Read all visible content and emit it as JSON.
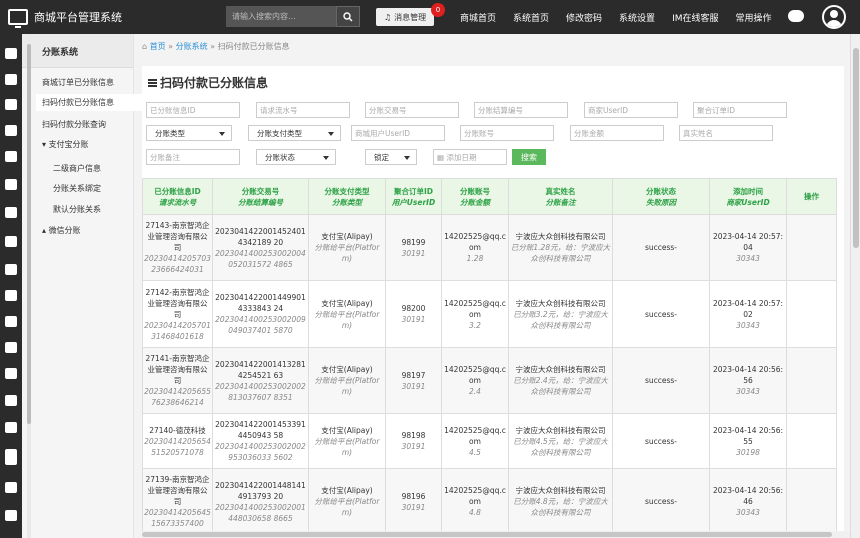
{
  "app": {
    "title": "商城平台管理系统"
  },
  "topbar": {
    "search_placeholder": "请输入搜索内容...",
    "msg_label": "消息管理",
    "msg_badge": "0",
    "nav": [
      "商城首页",
      "系统首页",
      "修改密码",
      "系统设置",
      "IM在线客服",
      "常用操作"
    ]
  },
  "sidebar": {
    "title": "分账系统",
    "items": [
      {
        "label": "商城订单已分账信息"
      },
      {
        "label": "扫码付款已分账信息"
      },
      {
        "label": "扫码付款分账查询"
      },
      {
        "label": "支付宝分账"
      },
      {
        "label": "二级商户信息"
      },
      {
        "label": "分账关系绑定"
      },
      {
        "label": "默认分账关系"
      },
      {
        "label": "微信分账"
      }
    ]
  },
  "breadcrumb": {
    "home": "首页",
    "sep": "»",
    "level1": "分账系统",
    "current": "扫码付款已分账信息"
  },
  "page": {
    "title": "扫码付款已分账信息"
  },
  "filters": {
    "row1": [
      "已分账信息ID",
      "请求流水号",
      "分账交易号",
      "分账结算编号",
      "商家UserID",
      "聚合订单ID"
    ],
    "row2_selects": [
      "分账类型",
      "分账支付类型"
    ],
    "row2_inputs": [
      "商城用户UserID",
      "分账账号",
      "分账金额",
      "真实姓名"
    ],
    "remark_placeholder": "分账备注",
    "status_select": "分账状态",
    "lock_select": "锁定",
    "date_placeholder": "添加日期",
    "search_label": "搜索"
  },
  "table": {
    "headers": [
      {
        "main": "已分账信息ID",
        "sub": "请求流水号"
      },
      {
        "main": "分账交易号",
        "sub": "分账结算编号"
      },
      {
        "main": "分账支付类型",
        "sub": "分账类型"
      },
      {
        "main": "聚合订单ID",
        "sub": "用户UserID"
      },
      {
        "main": "分账账号",
        "sub": "分账金额"
      },
      {
        "main": "真实姓名",
        "sub": "分账备注"
      },
      {
        "main": "分账状态",
        "sub": "失败原因"
      },
      {
        "main": "添加时间",
        "sub": "商家UserID"
      },
      {
        "main": "操作",
        "sub": ""
      }
    ],
    "rows": [
      {
        "id": "27143-南京智鸿企业管理咨询有限公司",
        "req": "2023041420570323666424031",
        "trade": "20230414220014524014342189 20",
        "settle": "2023041400253002004052031572 4865",
        "paytype": "支付宝(Alipay)",
        "type": "分账给平台(Platform)",
        "order": "98199",
        "uid": "30191",
        "account": "14202525@qq.com",
        "amount": "1.28",
        "name": "宁波应大众创科技有限公司",
        "remark": "已分账1.28元，给：宁波应大众创科技有限公司",
        "status": "success-",
        "reason": "",
        "time": "2023-04-14 20:57:04",
        "merchant": "30343"
      },
      {
        "id": "27142-南京智鸿企业管理咨询有限公司",
        "req": "2023041420570131468401618",
        "trade": "20230414220014499014333843 24",
        "settle": "2023041400253002009049037401 5870",
        "paytype": "支付宝(Alipay)",
        "type": "分账给平台(Platform)",
        "order": "98200",
        "uid": "30191",
        "account": "14202525@qq.com",
        "amount": "3.2",
        "name": "宁波应大众创科技有限公司",
        "remark": "已分账3.2元，给：宁波应大众创科技有限公司",
        "status": "success-",
        "reason": "",
        "time": "2023-04-14 20:57:02",
        "merchant": "30343"
      },
      {
        "id": "27141-南京智鸿企业管理咨询有限公司",
        "req": "2023041420565576238646214",
        "trade": "20230414220014132814254521 63",
        "settle": "2023041400253002002813037607 8351",
        "paytype": "支付宝(Alipay)",
        "type": "分账给平台(Platform)",
        "order": "98197",
        "uid": "30191",
        "account": "14202525@qq.com",
        "amount": "2.4",
        "name": "宁波应大众创科技有限公司",
        "remark": "已分账2.4元，给：宁波应大众创科技有限公司",
        "status": "success-",
        "reason": "",
        "time": "2023-04-14 20:56:56",
        "merchant": "30343"
      },
      {
        "id": "27140-德茂科技",
        "req": "2023041420565451520571078",
        "trade": "20230414220014533914450943 58",
        "settle": "2023041400253002002953036033 5602",
        "paytype": "支付宝(Alipay)",
        "type": "分账给平台(Platform)",
        "order": "98198",
        "uid": "30191",
        "account": "14202525@qq.com",
        "amount": "4.5",
        "name": "宁波应大众创科技有限公司",
        "remark": "已分账4.5元，给：宁波应大众创科技有限公司",
        "status": "success-",
        "reason": "",
        "time": "2023-04-14 20:56:55",
        "merchant": "30198"
      },
      {
        "id": "27139-南京智鸿企业管理咨询有限公司",
        "req": "2023041420564515673357400",
        "trade": "20230414220014481414913793 20",
        "settle": "2023041400253002001448030658 8665",
        "paytype": "支付宝(Alipay)",
        "type": "分账给平台(Platform)",
        "order": "98196",
        "uid": "30191",
        "account": "14202525@qq.com",
        "amount": "4.8",
        "name": "宁波应大众创科技有限公司",
        "remark": "已分账4.8元，给：宁波应大众创科技有限公司",
        "status": "success-",
        "reason": "",
        "time": "2023-04-14 20:56:46",
        "merchant": "30343"
      }
    ]
  }
}
